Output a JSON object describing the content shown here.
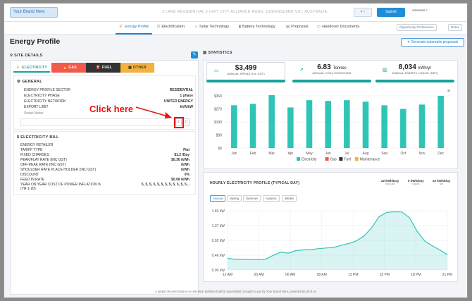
{
  "topbar": {
    "brand": "Your Brand Here",
    "address": "3 LAKE  RESIDENTIAL   3 UNIT CITY ALLIANCE ROAD, QUEENSLAND VIC, AUSTRALIA",
    "button": "Submit"
  },
  "nav": {
    "items": [
      {
        "label": "Energy Profile",
        "icon": "bolt-icon"
      },
      {
        "label": "Electrification",
        "icon": "plug-icon"
      },
      {
        "label": "Solar Technology",
        "icon": "sun-icon"
      },
      {
        "label": "Battery Technology",
        "icon": "battery-icon"
      },
      {
        "label": "Proposals",
        "icon": "document-icon"
      },
      {
        "label": "Handover Documents",
        "icon": "folder-icon"
      }
    ],
    "right": [
      "Opportunity Preferences",
      "Notes"
    ]
  },
  "page": {
    "title": "Energy Profile",
    "generate_button": "Generate automatic proposals"
  },
  "site_details": {
    "label": "SITE DETAILS",
    "tabs": [
      "ELECTRICITY",
      "GAS",
      "FUEL",
      "OTHER"
    ]
  },
  "general": {
    "title": "GENERAL",
    "rows": [
      {
        "k": "ENERGY PROFILE SECTOR",
        "v": "RESIDENTIAL"
      },
      {
        "k": "ELECTRICITY PHASE",
        "v": "1 phase"
      },
      {
        "k": "ELECTRICITY NETWORK",
        "v": "UNITED ENERGY"
      },
      {
        "k": "EXPORT LIMIT",
        "v": "kVA/kW"
      }
    ],
    "smart_meter_label": "Smart Meter"
  },
  "bill": {
    "title": "ELECTRICITY BILL",
    "rows": [
      {
        "k": "ENERGY RETAILER",
        "v": ""
      },
      {
        "k": "TARIFF TYPE",
        "v": "Flat"
      },
      {
        "k": "FIXED CHARGES",
        "v": "$1.2 /Day"
      },
      {
        "k": "PEAK/FLAT RATE (INC GST)",
        "v": "$0.36 /kWh"
      },
      {
        "k": "OFF-PEAK RATE (INC GST)",
        "v": "/kWh"
      },
      {
        "k": "SHOULDER RATE PLACE HOLDER (INC GST)",
        "v": "/kWh"
      },
      {
        "k": "DISCOUNT",
        "v": "0%"
      },
      {
        "k": "FEED IN RATE",
        "v": "$0.08 /kWh"
      },
      {
        "k": "YEAR ON YEAR COST OF POWER INFLATION %",
        "v": "5, 5, 5, 5, 5, 5, 5, 5, 5, 5, 5, 5..."
      },
      {
        "k": "(YR 1-20)",
        "v": ""
      }
    ]
  },
  "annotation": {
    "text": "Click here"
  },
  "statistics": {
    "label": "STATISTICS",
    "cards": [
      {
        "value": "$3,499",
        "unit": "",
        "label": "ANNUAL SPEND (inc GST)",
        "icon": "wallet-icon"
      },
      {
        "value": "6.83",
        "unit": "Tonnes",
        "label": "ANNUAL CO2e EMISSIONS",
        "icon": "trend-icon"
      },
      {
        "value": "8,034",
        "unit": "kWh/yr",
        "label": "ANNUAL ENERGY USAGE (NET)",
        "icon": "bar-chart-icon"
      }
    ]
  },
  "hourly": {
    "title": "HOURLY ELECTRICITY PROFILE (TYPICAL DAY)",
    "seasons": [
      "Annual",
      "Spring",
      "Summer",
      "Autumn",
      "Winter"
    ],
    "kwh": [
      {
        "value": "22 kWh/Day",
        "sub": "Grid Use"
      },
      {
        "value": "0 kWh/Day",
        "sub": "Export"
      },
      {
        "value": "22 kWh/Day",
        "sub": "Net"
      }
    ]
  },
  "footer": "A global decarbonisation acceleration platform built by SpendWatt, brought to you by Your Brand Here, powered by all of us",
  "colors": {
    "electricity": "#2ec4b6",
    "gas": "#f05a4b",
    "fuel": "#333333",
    "maintenance": "#f4b13e",
    "accent": "#1e8fd6"
  },
  "chart_data": [
    {
      "type": "bar",
      "categories": [
        "Jan",
        "Feb",
        "Mar",
        "Apr",
        "May",
        "Jun",
        "Jul",
        "Aug",
        "Sep",
        "Oct",
        "Nov",
        "Dec"
      ],
      "series": [
        {
          "name": "Electricity",
          "values": [
            295,
            305,
            365,
            280,
            330,
            325,
            330,
            320,
            295,
            270,
            300,
            360
          ]
        },
        {
          "name": "Gas",
          "values": [
            0,
            0,
            0,
            0,
            0,
            0,
            0,
            0,
            0,
            0,
            0,
            0
          ]
        },
        {
          "name": "Fuel",
          "values": [
            0,
            0,
            0,
            0,
            0,
            0,
            0,
            0,
            0,
            0,
            0,
            0
          ]
        },
        {
          "name": "Maintenance",
          "values": [
            0,
            0,
            0,
            0,
            0,
            0,
            0,
            0,
            0,
            0,
            0,
            0
          ]
        }
      ],
      "yticks": [
        "$0",
        "$90",
        "$180",
        "$270",
        "$360"
      ],
      "ylim": [
        0,
        360
      ],
      "legend": "bottom"
    },
    {
      "type": "area",
      "x": [
        "12 AM",
        "03 AM",
        "06 AM",
        "08 AM",
        "12 PM",
        "15 PM",
        "18 PM",
        "21 PM"
      ],
      "values": [
        0.36,
        0.33,
        0.33,
        0.32,
        0.32,
        0.33,
        0.45,
        0.55,
        0.52,
        0.6,
        0.62,
        0.63,
        0.66,
        0.68,
        0.7,
        0.76,
        0.82,
        0.9,
        1.05,
        1.3,
        1.65,
        1.78,
        1.8,
        1.79,
        1.62,
        1.2,
        0.9,
        0.75,
        0.62,
        0.47
      ],
      "yticks": [
        "0.00 kW",
        "0.46 kW",
        "0.92 kW",
        "1.37 kW",
        "1.83 kW"
      ],
      "ylim": [
        0,
        1.83
      ]
    }
  ]
}
